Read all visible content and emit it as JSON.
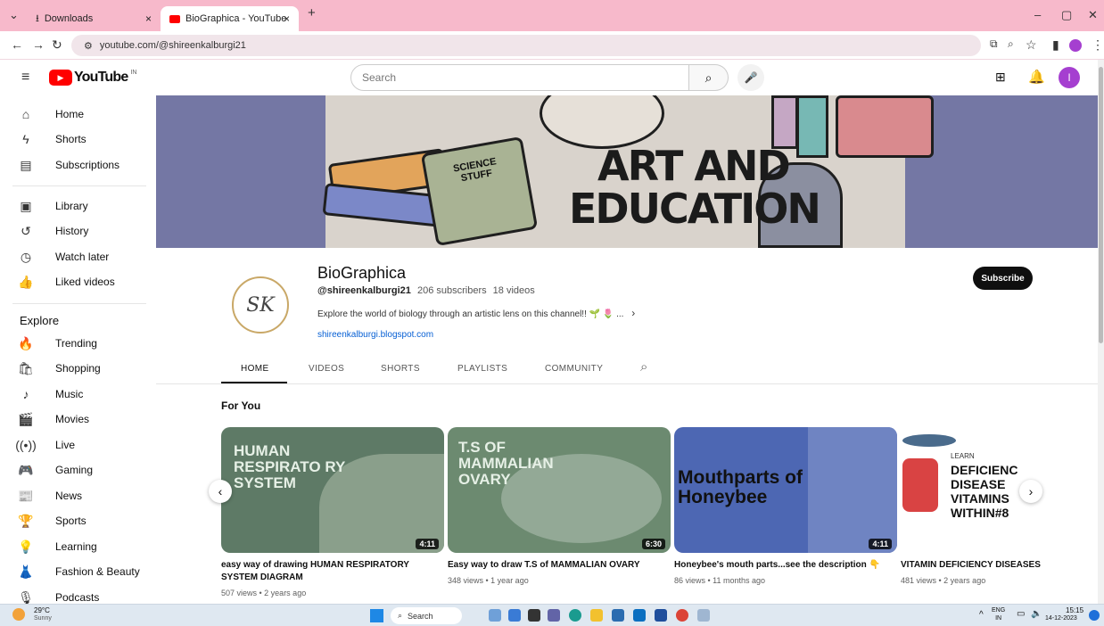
{
  "browser": {
    "tabs": [
      {
        "label": "Downloads"
      },
      {
        "label": "BioGraphica - YouTube"
      }
    ],
    "url": "youtube.com/@shireenkalburgi21"
  },
  "header": {
    "logo_text": "YouTube",
    "region": "IN",
    "search_placeholder": "Search",
    "avatar_letter": "I"
  },
  "sidebar": {
    "main": [
      {
        "label": "Home",
        "icon": "home-icon"
      },
      {
        "label": "Shorts",
        "icon": "shorts-icon"
      },
      {
        "label": "Subscriptions",
        "icon": "subscriptions-icon"
      }
    ],
    "you": [
      {
        "label": "Library",
        "icon": "library-icon"
      },
      {
        "label": "History",
        "icon": "history-icon"
      },
      {
        "label": "Watch later",
        "icon": "watch-later-icon"
      },
      {
        "label": "Liked videos",
        "icon": "liked-icon"
      }
    ],
    "explore_heading": "Explore",
    "explore": [
      {
        "label": "Trending"
      },
      {
        "label": "Shopping"
      },
      {
        "label": "Music"
      },
      {
        "label": "Movies"
      },
      {
        "label": "Live"
      },
      {
        "label": "Gaming"
      },
      {
        "label": "News"
      },
      {
        "label": "Sports"
      },
      {
        "label": "Learning"
      },
      {
        "label": "Fashion & Beauty"
      },
      {
        "label": "Podcasts"
      }
    ]
  },
  "banner": {
    "line1": "ART AND",
    "line2": "EDUCATION",
    "book_label": "SCIENCE STUFF"
  },
  "channel": {
    "name": "BioGraphica",
    "handle": "@shireenkalburgi21",
    "subscribers": "206 subscribers",
    "videos": "18 videos",
    "description": "Explore the world of biology through an artistic lens on this channel!! 🌱 🌷 ...",
    "link": "shireenkalburgi.blogspot.com",
    "avatar_text": "SK",
    "subscribe_label": "Subscribe"
  },
  "channel_tabs": [
    "HOME",
    "VIDEOS",
    "SHORTS",
    "PLAYLISTS",
    "COMMUNITY"
  ],
  "section_title": "For You",
  "videos": [
    {
      "thumb_text": "HUMAN RESPIRATO RY SYSTEM",
      "duration": "4:11",
      "title": "easy way of drawing HUMAN RESPIRATORY SYSTEM DIAGRAM",
      "meta": "507 views • 2 years ago"
    },
    {
      "thumb_text": "T.S OF MAMMALIAN OVARY",
      "duration": "6:30",
      "title": "Easy way to draw T.S of MAMMALIAN OVARY",
      "meta": "348 views • 1 year ago"
    },
    {
      "thumb_text": "Mouthparts of Honeybee",
      "duration": "4:11",
      "title": "Honeybee's mouth parts...see the description 👇",
      "meta": "86 views • 11 months ago"
    },
    {
      "thumb_text": "DEFICIENC DISEASE VITAMINS WITHIN#8",
      "thumb_small": "LEARN",
      "title": "VITAMIN DEFICIENCY DISEASES",
      "meta": "481 views • 2 years ago"
    }
  ],
  "taskbar": {
    "weather_temp": "29°C",
    "weather_desc": "Sunny",
    "search_label": "Search",
    "lang1": "ENG",
    "lang2": "IN",
    "time": "15:15",
    "date": "14-12-2023"
  }
}
